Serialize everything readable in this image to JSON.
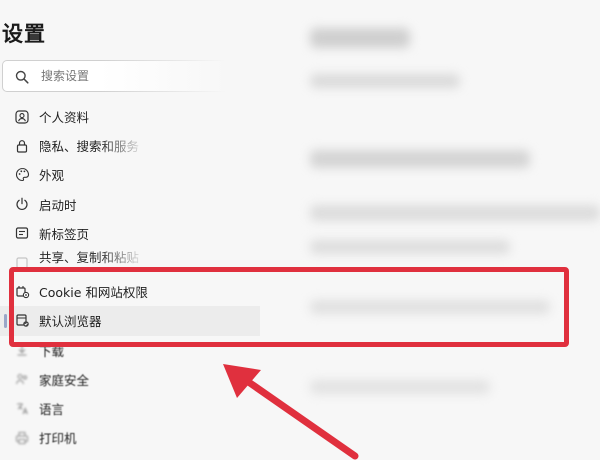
{
  "page": {
    "title": "设置"
  },
  "search": {
    "placeholder": "搜索设置"
  },
  "nav": {
    "items": [
      {
        "label": "个人资料",
        "icon": "profile-icon"
      },
      {
        "label": "隐私、搜索和服务",
        "icon": "lock-icon"
      },
      {
        "label": "外观",
        "icon": "appearance-icon"
      },
      {
        "label": "启动时",
        "icon": "power-icon"
      },
      {
        "label": "新标签页",
        "icon": "new-tab-icon"
      },
      {
        "label": "共享、复制和粘贴",
        "icon": "share-icon"
      },
      {
        "label": "Cookie 和网站权限",
        "icon": "cookie-permissions-icon"
      },
      {
        "label": "默认浏览器",
        "icon": "default-browser-icon"
      },
      {
        "label": "下载",
        "icon": "download-icon"
      },
      {
        "label": "家庭安全",
        "icon": "family-icon"
      },
      {
        "label": "语言",
        "icon": "language-icon"
      },
      {
        "label": "打印机",
        "icon": "printer-icon"
      }
    ]
  },
  "annotation": {
    "box_color": "#e0303e",
    "arrow_color": "#e0303e"
  }
}
